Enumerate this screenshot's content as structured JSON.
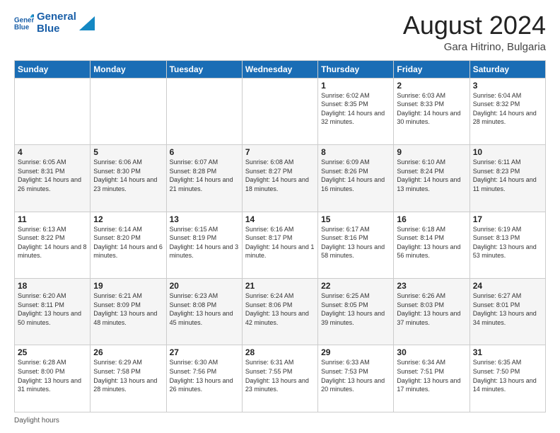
{
  "logo": {
    "line1": "General",
    "line2": "Blue"
  },
  "title": {
    "month_year": "August 2024",
    "location": "Gara Hitrino, Bulgaria"
  },
  "headers": [
    "Sunday",
    "Monday",
    "Tuesday",
    "Wednesday",
    "Thursday",
    "Friday",
    "Saturday"
  ],
  "weeks": [
    [
      {
        "day": "",
        "info": ""
      },
      {
        "day": "",
        "info": ""
      },
      {
        "day": "",
        "info": ""
      },
      {
        "day": "",
        "info": ""
      },
      {
        "day": "1",
        "info": "Sunrise: 6:02 AM\nSunset: 8:35 PM\nDaylight: 14 hours and 32 minutes."
      },
      {
        "day": "2",
        "info": "Sunrise: 6:03 AM\nSunset: 8:33 PM\nDaylight: 14 hours and 30 minutes."
      },
      {
        "day": "3",
        "info": "Sunrise: 6:04 AM\nSunset: 8:32 PM\nDaylight: 14 hours and 28 minutes."
      }
    ],
    [
      {
        "day": "4",
        "info": "Sunrise: 6:05 AM\nSunset: 8:31 PM\nDaylight: 14 hours and 26 minutes."
      },
      {
        "day": "5",
        "info": "Sunrise: 6:06 AM\nSunset: 8:30 PM\nDaylight: 14 hours and 23 minutes."
      },
      {
        "day": "6",
        "info": "Sunrise: 6:07 AM\nSunset: 8:28 PM\nDaylight: 14 hours and 21 minutes."
      },
      {
        "day": "7",
        "info": "Sunrise: 6:08 AM\nSunset: 8:27 PM\nDaylight: 14 hours and 18 minutes."
      },
      {
        "day": "8",
        "info": "Sunrise: 6:09 AM\nSunset: 8:26 PM\nDaylight: 14 hours and 16 minutes."
      },
      {
        "day": "9",
        "info": "Sunrise: 6:10 AM\nSunset: 8:24 PM\nDaylight: 14 hours and 13 minutes."
      },
      {
        "day": "10",
        "info": "Sunrise: 6:11 AM\nSunset: 8:23 PM\nDaylight: 14 hours and 11 minutes."
      }
    ],
    [
      {
        "day": "11",
        "info": "Sunrise: 6:13 AM\nSunset: 8:22 PM\nDaylight: 14 hours and 8 minutes."
      },
      {
        "day": "12",
        "info": "Sunrise: 6:14 AM\nSunset: 8:20 PM\nDaylight: 14 hours and 6 minutes."
      },
      {
        "day": "13",
        "info": "Sunrise: 6:15 AM\nSunset: 8:19 PM\nDaylight: 14 hours and 3 minutes."
      },
      {
        "day": "14",
        "info": "Sunrise: 6:16 AM\nSunset: 8:17 PM\nDaylight: 14 hours and 1 minute."
      },
      {
        "day": "15",
        "info": "Sunrise: 6:17 AM\nSunset: 8:16 PM\nDaylight: 13 hours and 58 minutes."
      },
      {
        "day": "16",
        "info": "Sunrise: 6:18 AM\nSunset: 8:14 PM\nDaylight: 13 hours and 56 minutes."
      },
      {
        "day": "17",
        "info": "Sunrise: 6:19 AM\nSunset: 8:13 PM\nDaylight: 13 hours and 53 minutes."
      }
    ],
    [
      {
        "day": "18",
        "info": "Sunrise: 6:20 AM\nSunset: 8:11 PM\nDaylight: 13 hours and 50 minutes."
      },
      {
        "day": "19",
        "info": "Sunrise: 6:21 AM\nSunset: 8:09 PM\nDaylight: 13 hours and 48 minutes."
      },
      {
        "day": "20",
        "info": "Sunrise: 6:23 AM\nSunset: 8:08 PM\nDaylight: 13 hours and 45 minutes."
      },
      {
        "day": "21",
        "info": "Sunrise: 6:24 AM\nSunset: 8:06 PM\nDaylight: 13 hours and 42 minutes."
      },
      {
        "day": "22",
        "info": "Sunrise: 6:25 AM\nSunset: 8:05 PM\nDaylight: 13 hours and 39 minutes."
      },
      {
        "day": "23",
        "info": "Sunrise: 6:26 AM\nSunset: 8:03 PM\nDaylight: 13 hours and 37 minutes."
      },
      {
        "day": "24",
        "info": "Sunrise: 6:27 AM\nSunset: 8:01 PM\nDaylight: 13 hours and 34 minutes."
      }
    ],
    [
      {
        "day": "25",
        "info": "Sunrise: 6:28 AM\nSunset: 8:00 PM\nDaylight: 13 hours and 31 minutes."
      },
      {
        "day": "26",
        "info": "Sunrise: 6:29 AM\nSunset: 7:58 PM\nDaylight: 13 hours and 28 minutes."
      },
      {
        "day": "27",
        "info": "Sunrise: 6:30 AM\nSunset: 7:56 PM\nDaylight: 13 hours and 26 minutes."
      },
      {
        "day": "28",
        "info": "Sunrise: 6:31 AM\nSunset: 7:55 PM\nDaylight: 13 hours and 23 minutes."
      },
      {
        "day": "29",
        "info": "Sunrise: 6:33 AM\nSunset: 7:53 PM\nDaylight: 13 hours and 20 minutes."
      },
      {
        "day": "30",
        "info": "Sunrise: 6:34 AM\nSunset: 7:51 PM\nDaylight: 13 hours and 17 minutes."
      },
      {
        "day": "31",
        "info": "Sunrise: 6:35 AM\nSunset: 7:50 PM\nDaylight: 13 hours and 14 minutes."
      }
    ]
  ],
  "footer": {
    "daylight_label": "Daylight hours"
  }
}
